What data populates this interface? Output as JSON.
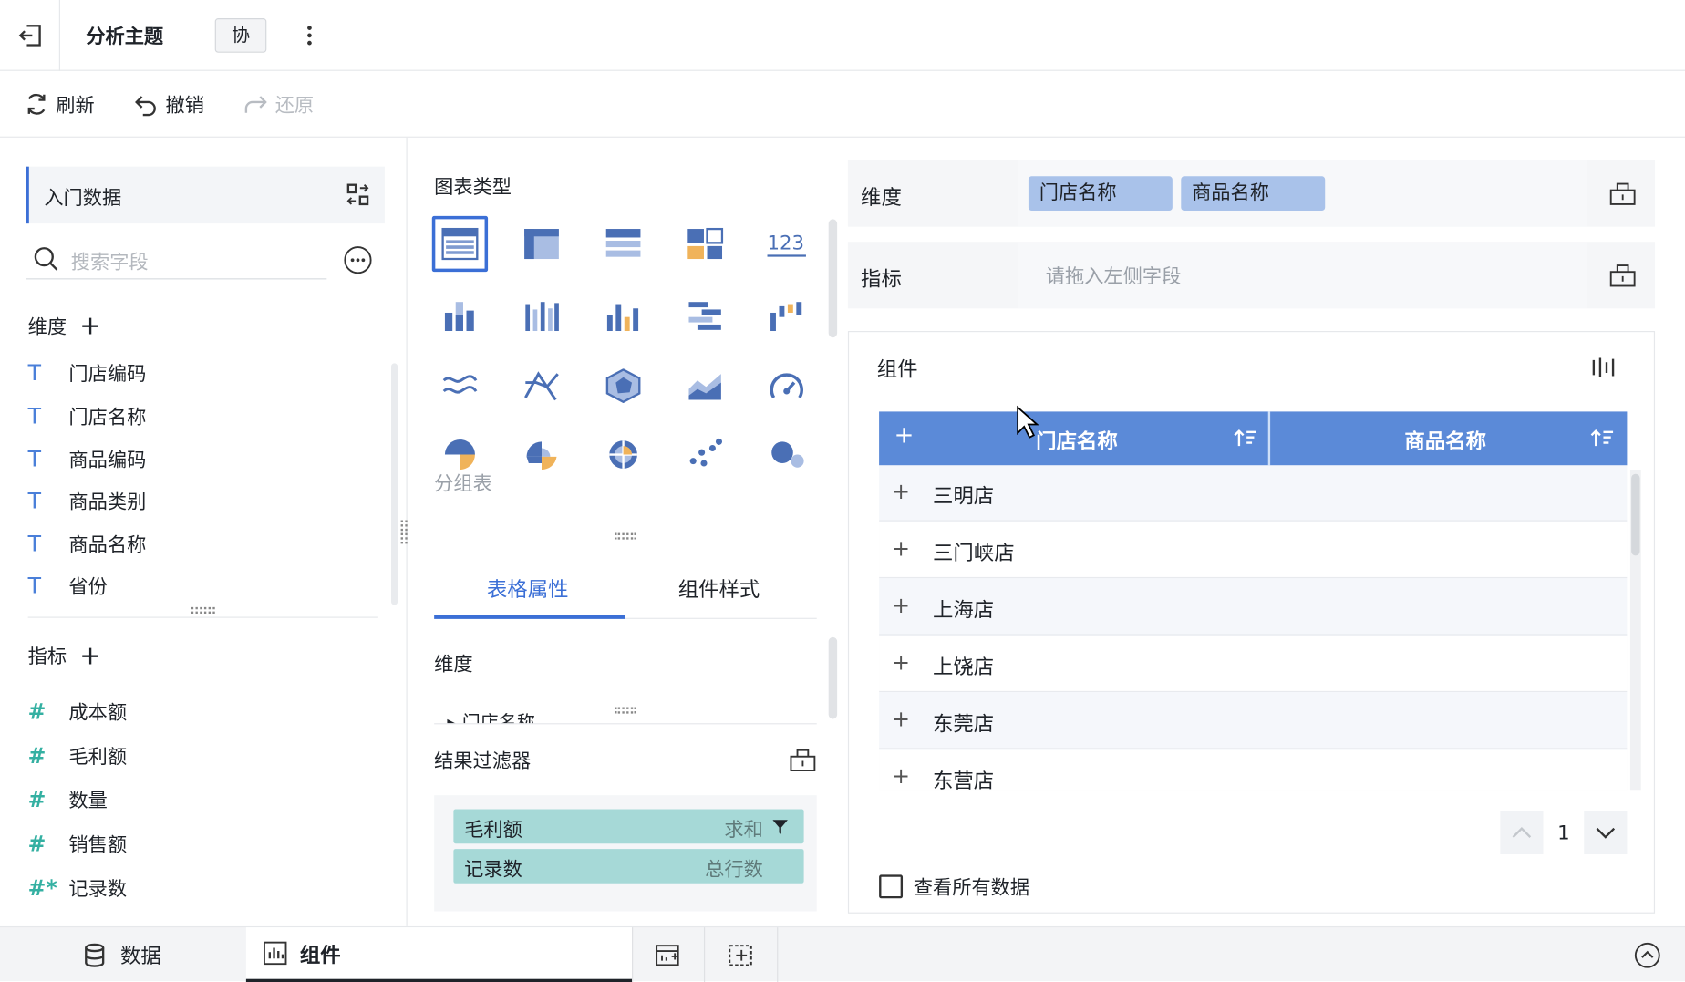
{
  "header": {
    "title": "分析主题",
    "collab_label": "协"
  },
  "toolbar": {
    "refresh": "刷新",
    "undo": "撤销",
    "redo": "还原"
  },
  "left": {
    "dataset_name": "入门数据",
    "search_placeholder": "搜索字段",
    "dimension_title": "维度",
    "dimensions": [
      "门店编码",
      "门店名称",
      "商品编码",
      "商品类别",
      "商品名称",
      "省份"
    ],
    "measure_title": "指标",
    "measures": [
      "成本额",
      "毛利额",
      "数量",
      "销售额",
      "记录数"
    ]
  },
  "middle": {
    "chart_types_title": "图表类型",
    "chart_type_tooltip": "分组表",
    "tabs": [
      "表格属性",
      "组件样式"
    ],
    "props_dimension_title": "维度",
    "props_dimension_item": "门店名称",
    "filter_title": "结果过滤器",
    "filters": [
      {
        "name": "毛利额",
        "agg": "求和"
      },
      {
        "name": "记录数",
        "agg": "总行数"
      }
    ]
  },
  "right": {
    "dimension_label": "维度",
    "dimension_chips": [
      "门店名称",
      "商品名称"
    ],
    "measure_label": "指标",
    "measure_placeholder": "请拖入左侧字段",
    "component_title": "组件",
    "table": {
      "columns": [
        "门店名称",
        "商品名称"
      ],
      "rows": [
        "三明店",
        "三门峡店",
        "上海店",
        "上饶店",
        "东莞店",
        "东营店"
      ]
    },
    "page_number": "1",
    "view_all_label": "查看所有数据"
  },
  "bottom": {
    "tab_data": "数据",
    "tab_component": "组件"
  },
  "colors": {
    "accent": "#3b6fd6",
    "table_header": "#5b8ad8",
    "chip": "#a9c2ea",
    "filter_pill": "#a6d9d7"
  }
}
